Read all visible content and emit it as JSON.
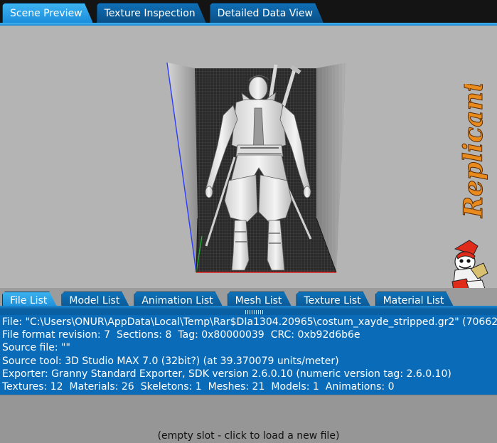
{
  "top_tabs": [
    {
      "label": "Scene Preview",
      "active": true
    },
    {
      "label": "Texture Inspection",
      "active": false
    },
    {
      "label": "Detailed Data View",
      "active": false
    }
  ],
  "bottom_tabs": [
    {
      "label": "File List",
      "active": true
    },
    {
      "label": "Model List",
      "active": false
    },
    {
      "label": "Animation List",
      "active": false
    },
    {
      "label": "Mesh List",
      "active": false
    },
    {
      "label": "Texture List",
      "active": false
    },
    {
      "label": "Material List",
      "active": false
    }
  ],
  "brand": {
    "text": "Replicant"
  },
  "file_info": {
    "file_line": "File: \"C:\\Users\\ONUR\\AppData\\Local\\Temp\\Rar$DIa1304.20965\\costum_xayde_stripped.gr2\" (70662",
    "format_revision": "File format revision: 7",
    "sections": "Sections: 8",
    "tag": "Tag: 0x80000039",
    "crc": "CRC: 0xb92d6b6e",
    "source_file": "Source file: \"\"",
    "source_tool": "Source tool: 3D Studio MAX 7.0 (32bit?) (at 39.370079 units/meter)",
    "exporter": "Exporter: Granny Standard Exporter, SDK version 2.6.0.10 (numeric version tag: 2.6.0.10)",
    "textures": "Textures: 12",
    "materials": "Materials: 26",
    "skeletons": "Skeletons: 1",
    "meshes": "Meshes: 21",
    "models": "Models: 1",
    "animations": "Animations: 0"
  },
  "empty_slot": {
    "label": "(empty slot - click to load a new file)"
  },
  "colors": {
    "tab_active": "#2fa6ea",
    "tab_inactive": "#0d68ad",
    "info_panel": "#0a6cb8",
    "brand_orange": "#e98a1c"
  }
}
